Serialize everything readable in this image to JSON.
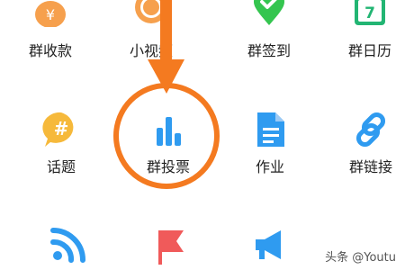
{
  "grid": {
    "row1": [
      {
        "label": "群收款",
        "icon": "money-bag-icon"
      },
      {
        "label": "小视频",
        "icon": "video-icon"
      },
      {
        "label": "群签到",
        "icon": "location-check-icon"
      },
      {
        "label": "群日历",
        "icon": "calendar-icon",
        "calendar_day": "7"
      }
    ],
    "row2": [
      {
        "label": "话题",
        "icon": "hashtag-bubble-icon",
        "glyph": "#"
      },
      {
        "label": "群投票",
        "icon": "bar-chart-icon"
      },
      {
        "label": "作业",
        "icon": "document-icon"
      },
      {
        "label": "群链接",
        "icon": "link-icon"
      }
    ],
    "row3": [
      {
        "label": "",
        "icon": "wifi-feed-icon"
      },
      {
        "label": "",
        "icon": "flag-icon"
      },
      {
        "label": "",
        "icon": "megaphone-icon"
      }
    ]
  },
  "money_symbol": "¥",
  "watermark": "头条 @Youtu",
  "colors": {
    "orange": "#f47a20",
    "orange_icon": "#f6a04d",
    "green": "#34c54f",
    "teal": "#22b573",
    "blue": "#2f9bf0",
    "yellow": "#f6b93b",
    "red": "#f05a5a"
  }
}
